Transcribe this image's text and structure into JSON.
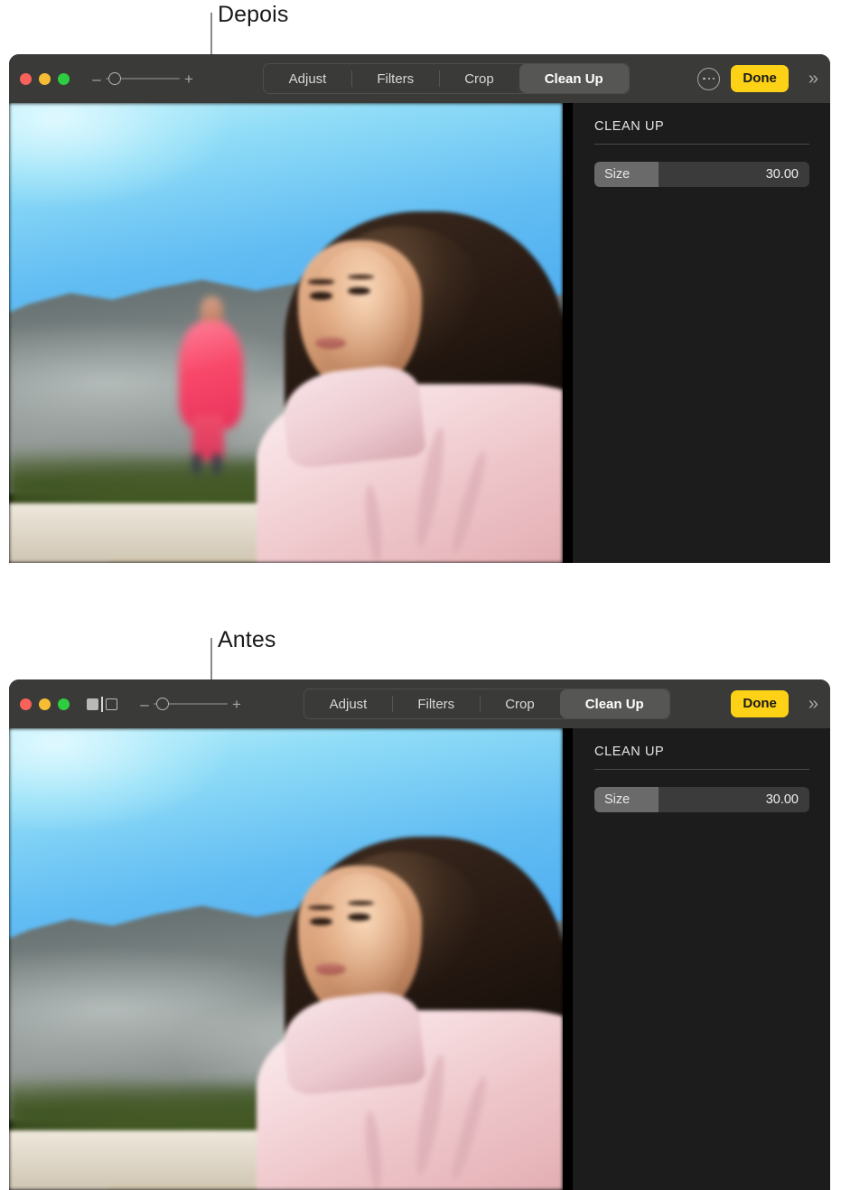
{
  "callouts": [
    {
      "label": "Depois",
      "name": "callout-depois"
    },
    {
      "label": "Antes",
      "name": "callout-antes"
    }
  ],
  "windows": [
    {
      "id": "after",
      "toolbar": {
        "traffic_lights": [
          "close",
          "minimize",
          "zoom"
        ],
        "has_compare_icon": false,
        "zoom_out_label": "–",
        "zoom_in_label": "+",
        "tabs": [
          {
            "label": "Adjust",
            "active": false
          },
          {
            "label": "Filters",
            "active": false
          },
          {
            "label": "Crop",
            "active": false
          },
          {
            "label": "Clean Up",
            "active": true
          }
        ],
        "has_more_button": true,
        "more_label": "more-options",
        "done_label": "Done",
        "expand_label": "»"
      },
      "sidebar": {
        "title": "CLEAN UP",
        "slider": {
          "label": "Size",
          "value": "30.00",
          "fill_percent": 30
        }
      },
      "photo": {
        "has_background_person": true
      }
    },
    {
      "id": "before",
      "toolbar": {
        "traffic_lights": [
          "close",
          "minimize",
          "zoom"
        ],
        "has_compare_icon": true,
        "compare_icon_name": "compare-before-after-icon",
        "zoom_out_label": "–",
        "zoom_in_label": "+",
        "tabs": [
          {
            "label": "Adjust",
            "active": false
          },
          {
            "label": "Filters",
            "active": false
          },
          {
            "label": "Crop",
            "active": false
          },
          {
            "label": "Clean Up",
            "active": true
          }
        ],
        "has_more_button": false,
        "done_label": "Done",
        "expand_label": "»"
      },
      "sidebar": {
        "title": "CLEAN UP",
        "slider": {
          "label": "Size",
          "value": "30.00",
          "fill_percent": 30
        }
      },
      "photo": {
        "has_background_person": false
      }
    }
  ],
  "colors": {
    "toolbar_bg": "#3a3a38",
    "sidebar_bg": "#1c1c1c",
    "done_accent": "#fcd116",
    "active_tab_bg": "#565654",
    "traffic_red": "#f9615b",
    "traffic_yellow": "#f6bd34",
    "traffic_green": "#2ecc40",
    "page_bg": "#ffffff",
    "callout_line": "#8a8a8a"
  }
}
